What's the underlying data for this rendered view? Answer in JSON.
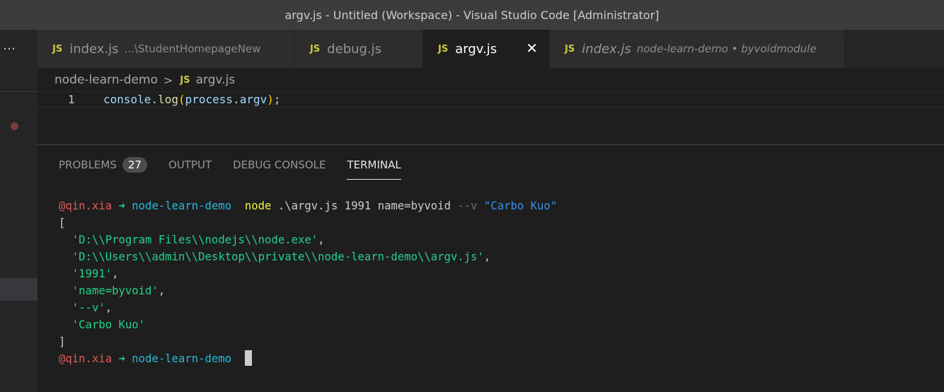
{
  "window": {
    "title": "argv.js - Untitled (Workspace) - Visual Studio Code [Administrator]"
  },
  "sidebar": {
    "more_label": "…"
  },
  "tabs": [
    {
      "badge": "JS",
      "name": "index.js",
      "description": "...\\StudentHomepageNew"
    },
    {
      "badge": "JS",
      "name": "debug.js",
      "description": ""
    },
    {
      "badge": "JS",
      "name": "argv.js",
      "description": "",
      "active": true,
      "close": "✕"
    },
    {
      "badge": "JS",
      "name": "index.js",
      "description": "node-learn-demo • byvoidmodule"
    }
  ],
  "breadcrumb": {
    "folder": "node-learn-demo",
    "separator": ">",
    "badge": "JS",
    "file": "argv.js"
  },
  "editor": {
    "line_number": "1",
    "tokens": {
      "obj": "console",
      "dot1": ".",
      "fn": "log",
      "open": "(",
      "arg_obj": "process",
      "dot2": ".",
      "arg_prop": "argv",
      "close": ")",
      "semi": ";"
    }
  },
  "panel": {
    "tabs": {
      "problems": "PROBLEMS",
      "problems_count": "27",
      "output": "OUTPUT",
      "debug_console": "DEBUG CONSOLE",
      "terminal": "TERMINAL"
    }
  },
  "terminal": {
    "prompt_user": "@qin.xia",
    "prompt_arrow": "➜",
    "prompt_dir": "node-learn-demo",
    "cmd": "node",
    "cmd_file": ".\\argv.js",
    "cmd_arg1": "1991",
    "cmd_arg2": "name=byvoid",
    "cmd_flag": "--v",
    "cmd_quoted": "\"Carbo Kuo\"",
    "open_bracket": "[",
    "output_lines": [
      "'D:\\\\Program Files\\\\nodejs\\\\node.exe'",
      "'D:\\\\Users\\\\admin\\\\Desktop\\\\private\\\\node-learn-demo\\\\argv.js'",
      "'1991'",
      "'name=byvoid'",
      "'--v'",
      "'Carbo Kuo'"
    ],
    "comma": ",",
    "close_bracket": "]"
  }
}
